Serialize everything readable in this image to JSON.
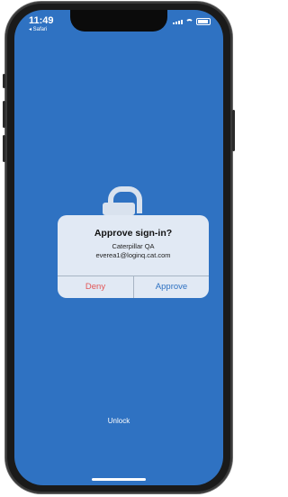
{
  "status_bar": {
    "time": "11:49",
    "back_label": "◂ Safari"
  },
  "alert": {
    "title": "Approve sign-in?",
    "organization": "Caterpillar QA",
    "email": "everea1@loginq.cat.com",
    "deny_label": "Deny",
    "approve_label": "Approve"
  },
  "unlock_label": "Unlock",
  "colors": {
    "background": "#2f72c2",
    "deny": "#e25555",
    "approve": "#2f72c2"
  }
}
